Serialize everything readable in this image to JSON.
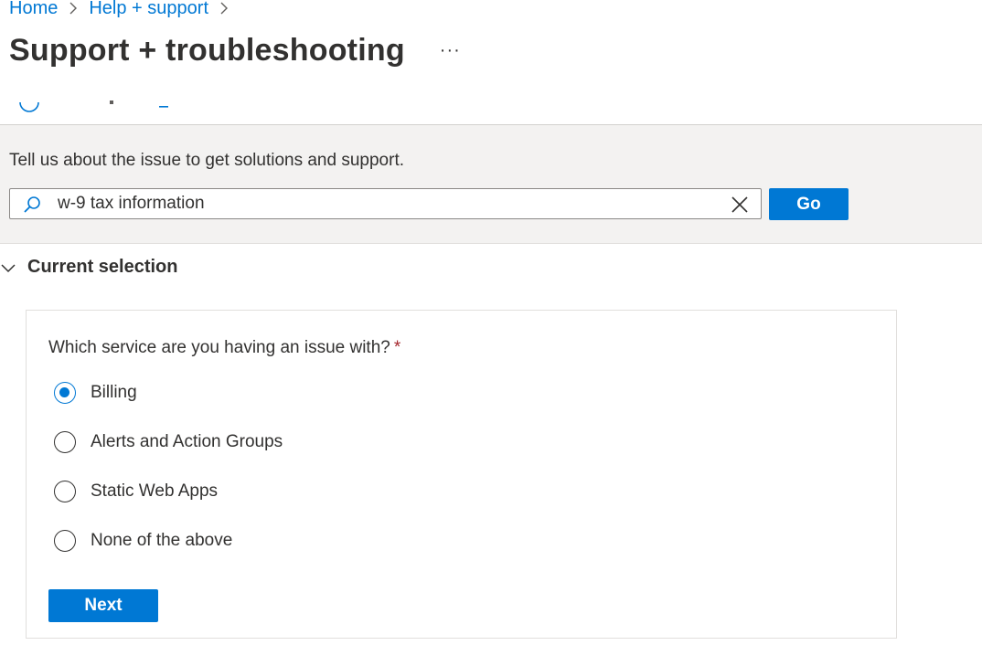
{
  "breadcrumb": {
    "items": [
      "Home",
      "Help + support"
    ]
  },
  "header": {
    "title": "Support + troubleshooting",
    "more": "···"
  },
  "banner": {
    "prompt": "Tell us about the issue to get solutions and support.",
    "search": {
      "value": "w-9 tax information",
      "placeholder": ""
    },
    "go_label": "Go"
  },
  "section": {
    "title": "Current selection"
  },
  "form": {
    "question": "Which service are you having an issue with?",
    "required_mark": "*",
    "options": [
      {
        "label": "Billing",
        "selected": true
      },
      {
        "label": "Alerts and Action Groups",
        "selected": false
      },
      {
        "label": "Static Web Apps",
        "selected": false
      },
      {
        "label": "None of the above",
        "selected": false
      }
    ],
    "next_label": "Next"
  },
  "colors": {
    "accent": "#0078d4",
    "banner_bg": "#f3f2f1",
    "required": "#a4262c"
  },
  "icons": {
    "search": "search-icon",
    "clear": "close-icon",
    "chevron": "chevron-down-icon",
    "breadcrumb_sep": "chevron-right-icon"
  }
}
